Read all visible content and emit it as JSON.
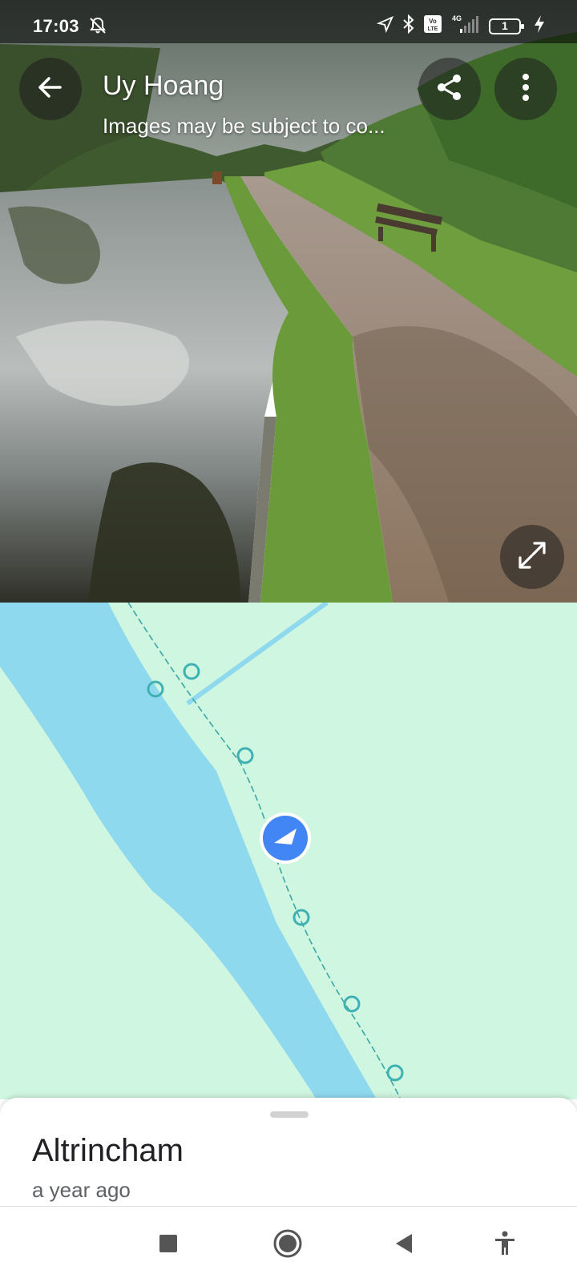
{
  "status_bar": {
    "time": "17:03",
    "battery_level": "1",
    "network": "4G",
    "volte": "Vo LTE",
    "icons": [
      "notifications-off-icon",
      "location-arrow-icon",
      "bluetooth-icon",
      "volte-icon",
      "signal-icon",
      "battery-icon",
      "charging-icon"
    ]
  },
  "header": {
    "contributor": "Uy Hoang",
    "copyright_note": "Images may be subject to co...",
    "icons": [
      "back-arrow-icon",
      "share-icon",
      "more-vert-icon"
    ]
  },
  "photo": {
    "expand_icon": "expand-icon"
  },
  "map": {
    "marker_icon": "navigation-arrow-icon",
    "colors": {
      "land": "#cff6e0",
      "water": "#8fd9ee",
      "marker": "#4285f4",
      "photo_points": "#3fb1b3"
    }
  },
  "place": {
    "title": "Altrincham",
    "subtitle": "a year ago"
  },
  "nav_bar": {
    "icons": [
      "recents-square-icon",
      "home-circle-icon",
      "back-triangle-icon",
      "accessibility-icon"
    ]
  }
}
